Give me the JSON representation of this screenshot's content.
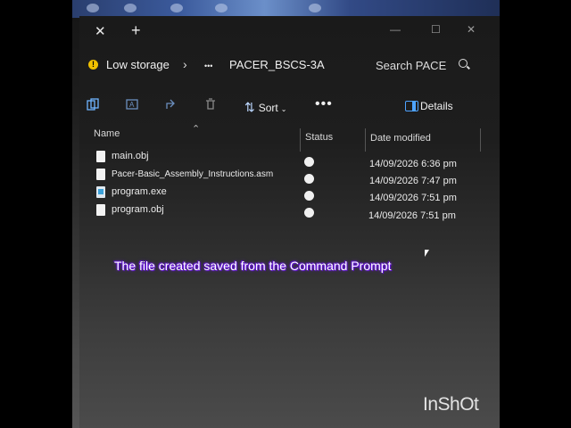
{
  "tabbar": {
    "close_glyph": "✕",
    "new_tab_glyph": "+"
  },
  "addressbar": {
    "warning_label": "Low storage",
    "separator": "›",
    "ellipsis": "•••",
    "current_folder": "PACER_BSCS-3A",
    "search_placeholder": "Search PACE"
  },
  "toolbar": {
    "icons": [
      "copy-icon",
      "rename-icon",
      "share-icon",
      "delete-icon"
    ],
    "sort_label": "Sort",
    "more_label": "•••",
    "details_label": "Details"
  },
  "columns": {
    "name": "Name",
    "status": "Status",
    "date_modified": "Date modified"
  },
  "files": [
    {
      "name": "main.obj",
      "type": "file",
      "date": "14/09/2026 6:36 pm"
    },
    {
      "name": "Pacer-Basic_Assembly_Instructions.asm",
      "type": "file",
      "date": "14/09/2026 7:47 pm"
    },
    {
      "name": "program.exe",
      "type": "exe",
      "date": "14/09/2026 7:51 pm"
    },
    {
      "name": "program.obj",
      "type": "file",
      "date": "14/09/2026 7:51 pm"
    }
  ],
  "caption": "The file created saved from the Command Prompt",
  "watermark": "InShOt",
  "colors": {
    "accent": "#4ea3ff",
    "warning": "#f0c000",
    "caption_glow": "#6a1fd6"
  }
}
